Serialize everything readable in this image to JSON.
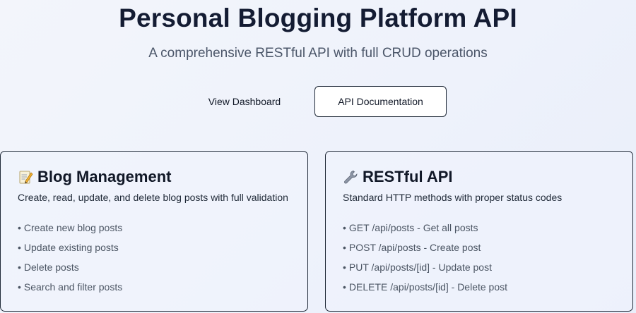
{
  "hero": {
    "title": "Personal Blogging Platform API",
    "subtitle": "A comprehensive RESTful API with full CRUD operations"
  },
  "actions": {
    "dashboard_label": "View Dashboard",
    "docs_label": "API Documentation"
  },
  "cards": [
    {
      "icon": "memo-icon",
      "title": "Blog Management",
      "description": "Create, read, update, and delete blog posts with full validation",
      "items": [
        "Create new blog posts",
        "Update existing posts",
        "Delete posts",
        "Search and filter posts"
      ]
    },
    {
      "icon": "wrench-icon",
      "title": "RESTful API",
      "description": "Standard HTTP methods with proper status codes",
      "items": [
        "GET /api/posts - Get all posts",
        "POST /api/posts - Create post",
        "PUT /api/posts/[id] - Update post",
        "DELETE /api/posts/[id] - Delete post"
      ]
    }
  ],
  "bullet": "•"
}
